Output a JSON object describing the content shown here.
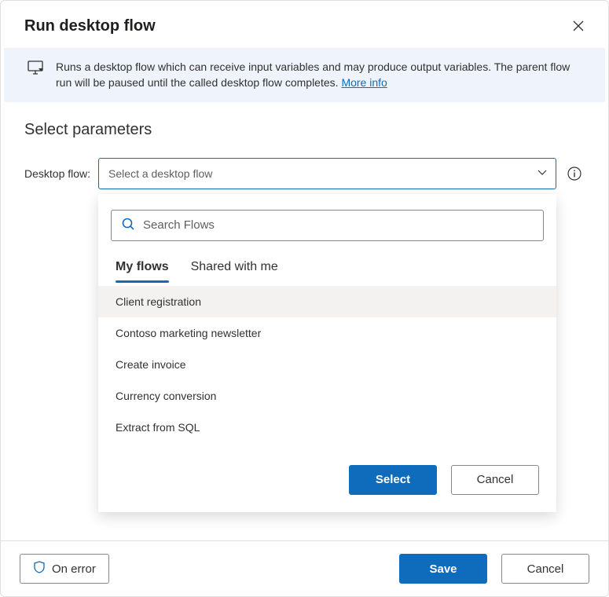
{
  "dialog": {
    "title": "Run desktop flow"
  },
  "banner": {
    "text": "Runs a desktop flow which can receive input variables and may produce output variables. The parent flow run will be paused until the called desktop flow completes. ",
    "link_text": "More info"
  },
  "section": {
    "title": "Select parameters"
  },
  "field": {
    "label": "Desktop flow:",
    "placeholder": "Select a desktop flow"
  },
  "panel": {
    "search_placeholder": "Search Flows",
    "tabs": {
      "my_flows": "My flows",
      "shared": "Shared with me"
    },
    "items": [
      "Client registration",
      "Contoso marketing newsletter",
      "Create invoice",
      "Currency conversion",
      "Extract from SQL"
    ],
    "select_label": "Select",
    "cancel_label": "Cancel"
  },
  "footer": {
    "on_error_label": "On error",
    "save_label": "Save",
    "cancel_label": "Cancel"
  }
}
